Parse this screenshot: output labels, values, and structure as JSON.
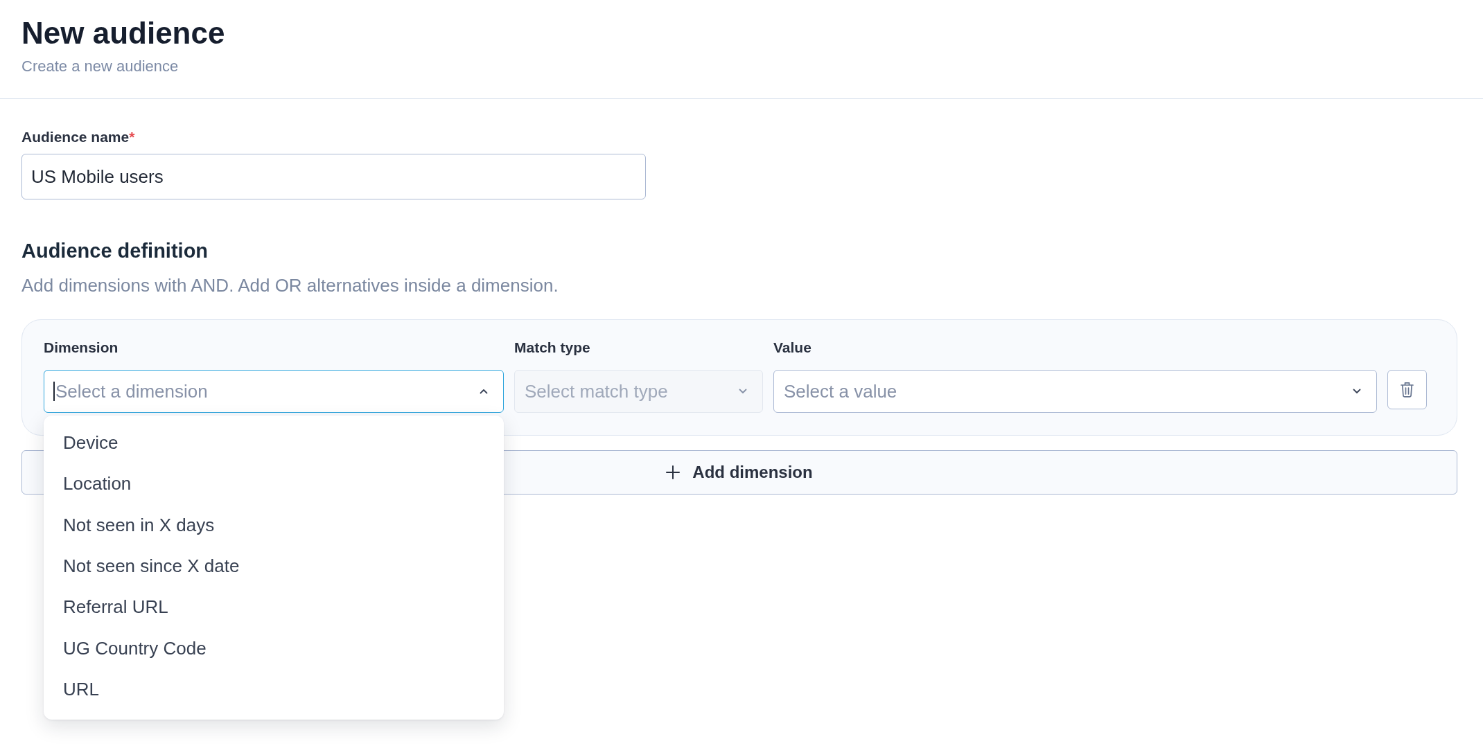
{
  "header": {
    "title": "New audience",
    "subtitle": "Create a new audience"
  },
  "audience_name": {
    "label": "Audience name",
    "required_mark": "*",
    "value": "US Mobile users"
  },
  "definition": {
    "title": "Audience definition",
    "description": "Add dimensions with AND. Add OR alternatives inside a dimension.",
    "rows": [
      {
        "fields": [
          {
            "label": "Dimension",
            "placeholder": "Select a dimension",
            "focused": true,
            "disabled": false,
            "expanded": true,
            "options": [
              {
                "label": "Device",
                "selected": false
              },
              {
                "label": "Location",
                "selected": false
              },
              {
                "label": "Not seen in X days",
                "selected": false
              },
              {
                "label": "Not seen since X date",
                "selected": false
              },
              {
                "label": "Referral URL",
                "selected": false
              },
              {
                "label": "UG Country Code",
                "selected": false
              },
              {
                "label": "URL",
                "selected": false
              }
            ]
          },
          {
            "label": "Match type",
            "placeholder": "Select match type",
            "focused": false,
            "disabled": true,
            "expanded": false
          },
          {
            "label": "Value",
            "placeholder": "Select a value",
            "focused": false,
            "disabled": false,
            "expanded": false
          }
        ]
      }
    ],
    "add_button": {
      "label": "Add dimension"
    }
  }
}
